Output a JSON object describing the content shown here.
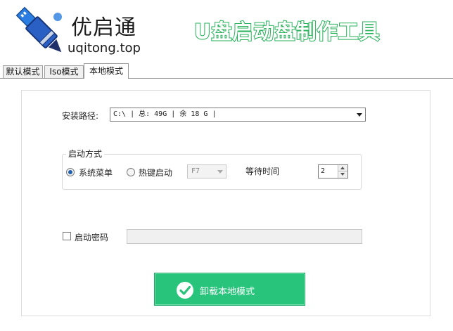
{
  "header": {
    "brand_name": "优启通",
    "brand_url": "uqitong.top",
    "slogan": "U盘启动盘制作工具",
    "logo_icon": "usb-drive-logo-icon",
    "accent_color": "#27b15a"
  },
  "tabs": [
    {
      "label": "默认模式",
      "active": false
    },
    {
      "label": "Iso模式",
      "active": false
    },
    {
      "label": "本地模式",
      "active": true
    }
  ],
  "install": {
    "path_label": "安装路径:",
    "path_value": "C:\\ | 总: 49G | 余 18 G |"
  },
  "boot": {
    "group_label": "启动方式",
    "system_menu_label": "系统菜单",
    "system_menu_checked": true,
    "hotkey_label": "热键启动",
    "hotkey_checked": false,
    "hotkey_value": "F7",
    "wait_label": "等待时间",
    "wait_value": "2"
  },
  "password": {
    "label": "启动密码",
    "checked": false,
    "value": ""
  },
  "action": {
    "uninstall_label": "卸载本地模式",
    "button_color": "#28c47c",
    "icon": "check-circle-icon"
  }
}
